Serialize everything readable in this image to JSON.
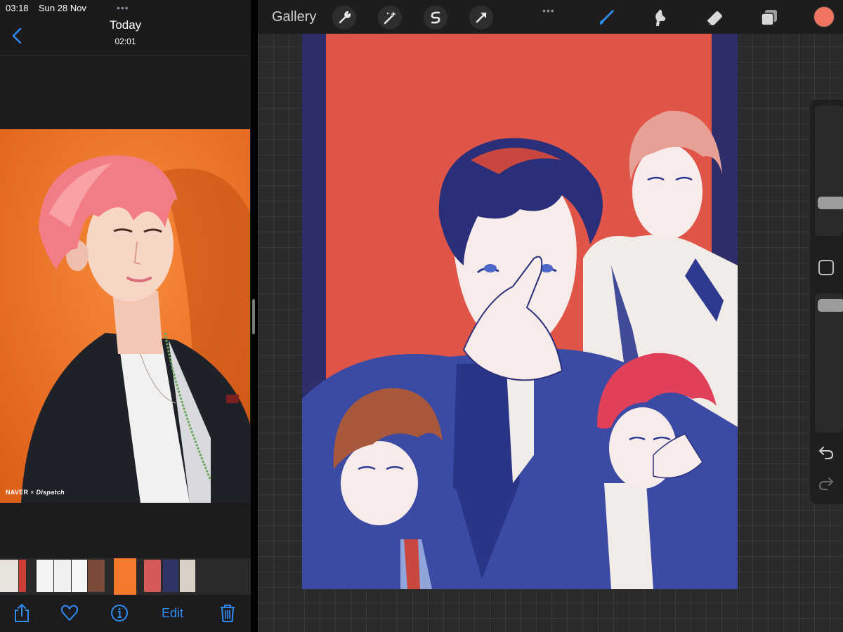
{
  "status_bar": {
    "time": "03:18",
    "date": "Sun 28 Nov"
  },
  "photos_app": {
    "title": "Today",
    "subtitle": "02:01",
    "photo": {
      "watermark_brand": "NAVER",
      "watermark_times": "×",
      "watermark_partner": "Dispatch"
    },
    "toolbar": {
      "edit_label": "Edit"
    },
    "icons": {
      "back": "chevron-left-icon",
      "share": "share-icon",
      "favorite": "heart-icon",
      "info": "info-icon",
      "delete": "trash-icon"
    }
  },
  "procreate": {
    "gallery_label": "Gallery",
    "tools_left": [
      "wrench-icon",
      "magic-wand-icon",
      "selection-icon",
      "transform-arrow-icon"
    ],
    "tools_right": [
      "brush-icon",
      "smudge-icon",
      "eraser-icon",
      "layers-icon"
    ],
    "current_color": "#ef7562",
    "sidebar": {
      "brush_size": 0.13,
      "opacity": 0.06,
      "undo": "undo-icon",
      "redo": "redo-icon"
    }
  },
  "colors": {
    "accent_blue": "#2f8bf5",
    "canvas_red": "#e05548",
    "canvas_navy": "#2e2f6a"
  }
}
